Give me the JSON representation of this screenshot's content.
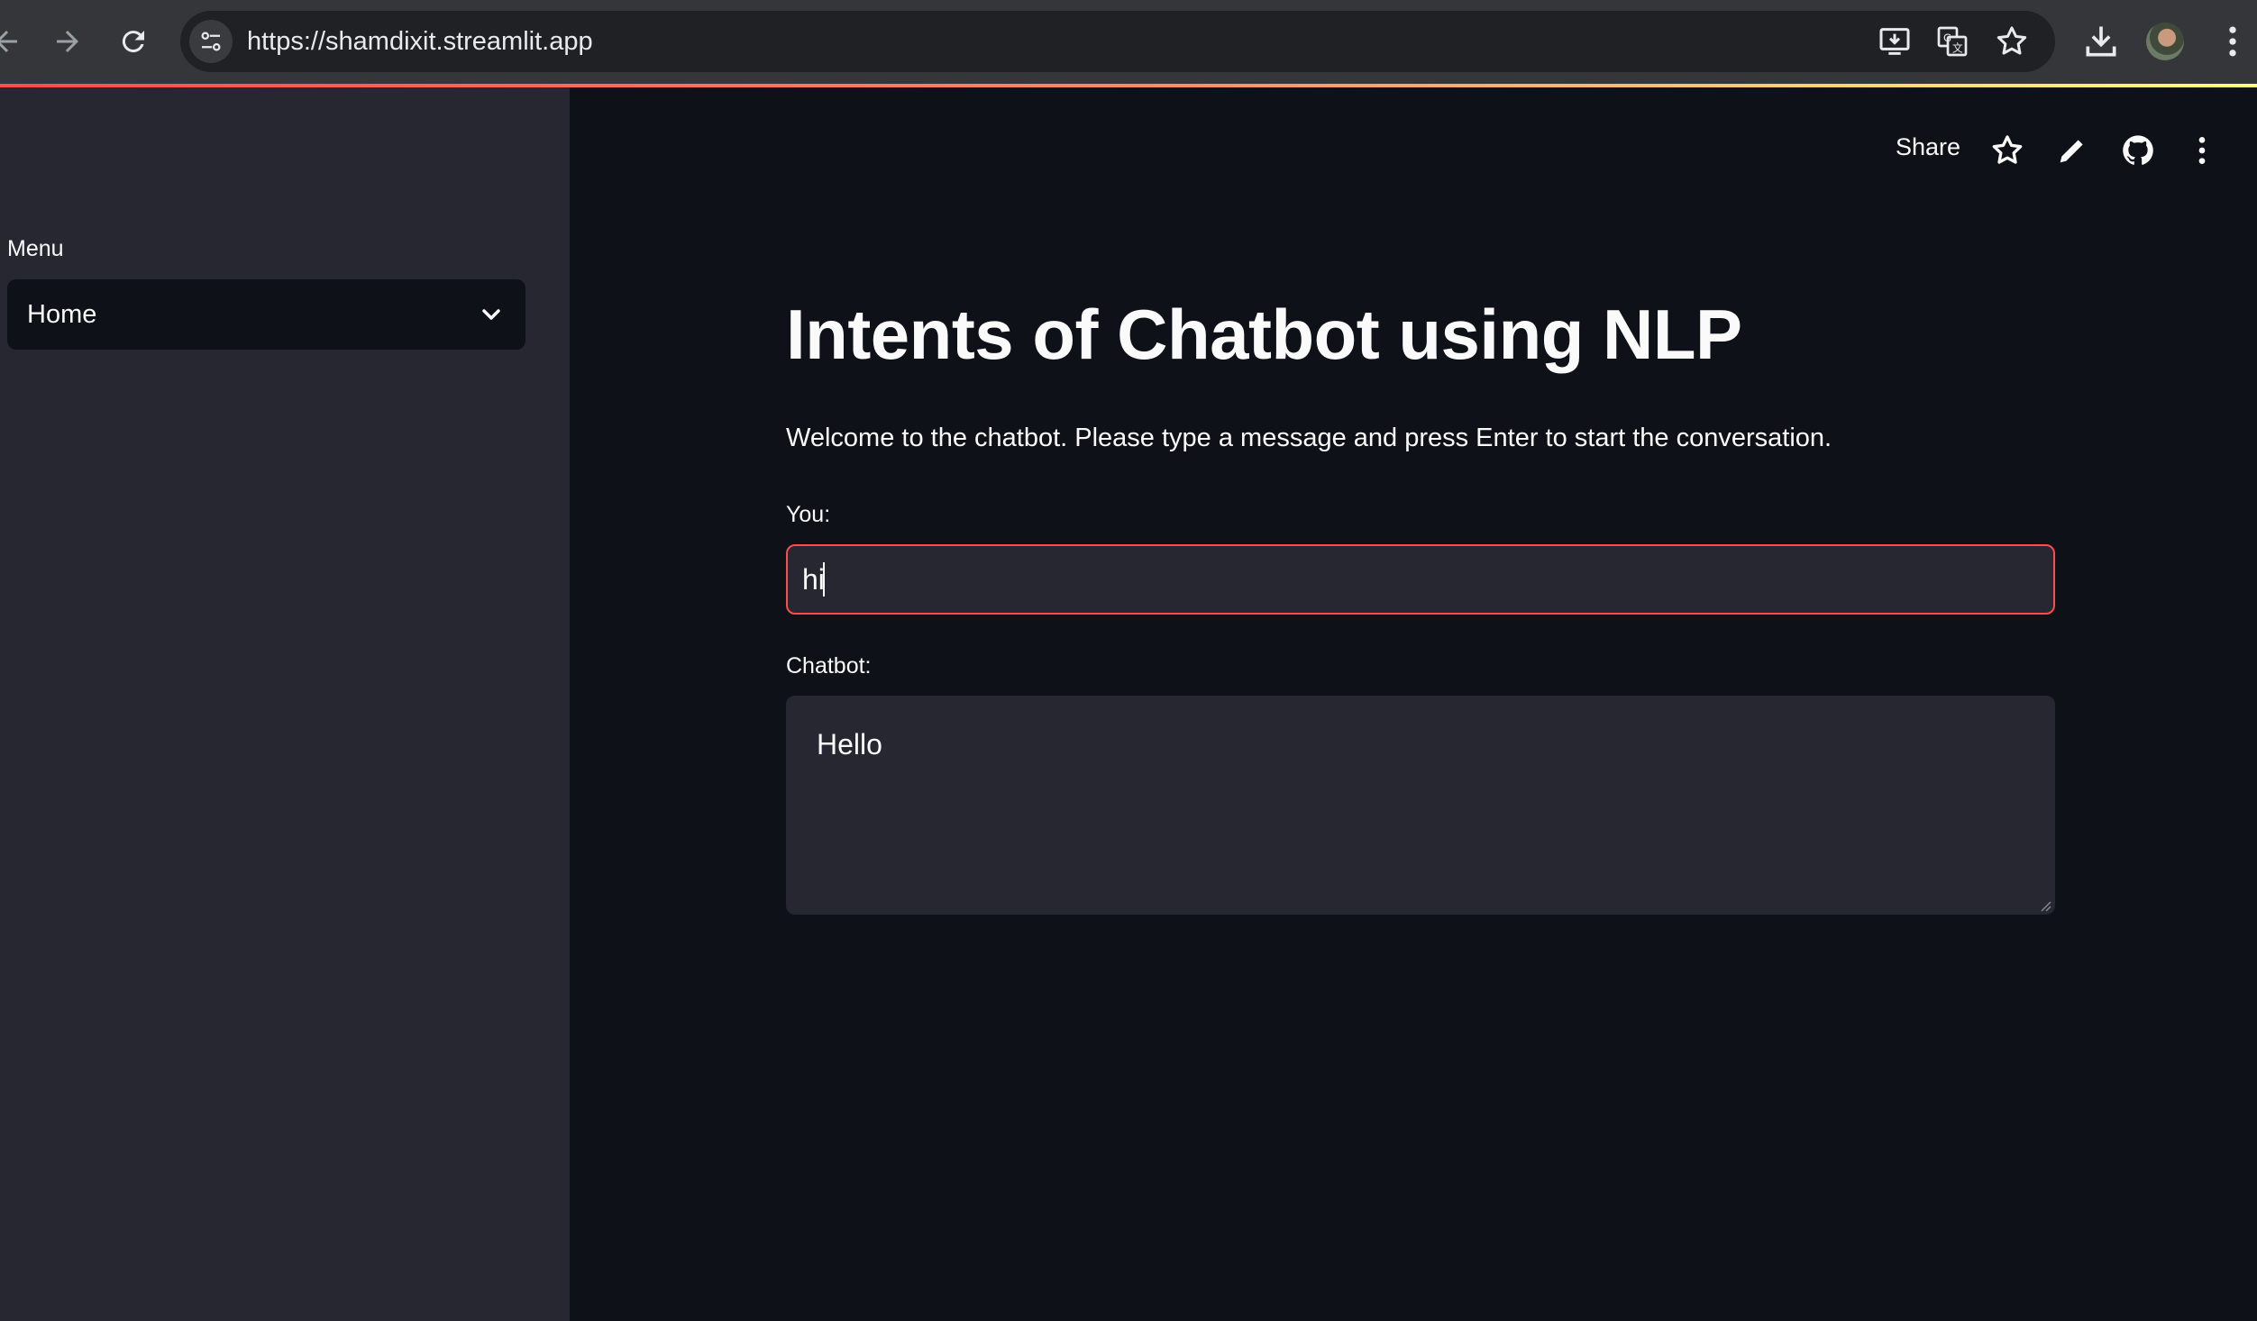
{
  "browser": {
    "url": "https://shamdixit.streamlit.app"
  },
  "sidebar": {
    "menu_label": "Menu",
    "select": {
      "selected": "Home"
    }
  },
  "toolbar": {
    "share_label": "Share"
  },
  "main": {
    "title": "Intents of Chatbot using NLP",
    "welcome": "Welcome to the chatbot. Please type a message and press Enter to start the conversation.",
    "you_label": "You:",
    "you_value": "hi",
    "chatbot_label": "Chatbot:",
    "chatbot_value": "Hello"
  },
  "colors": {
    "accent": "#ff4b4b",
    "background": "#0e1117",
    "sidebar": "#262730"
  }
}
